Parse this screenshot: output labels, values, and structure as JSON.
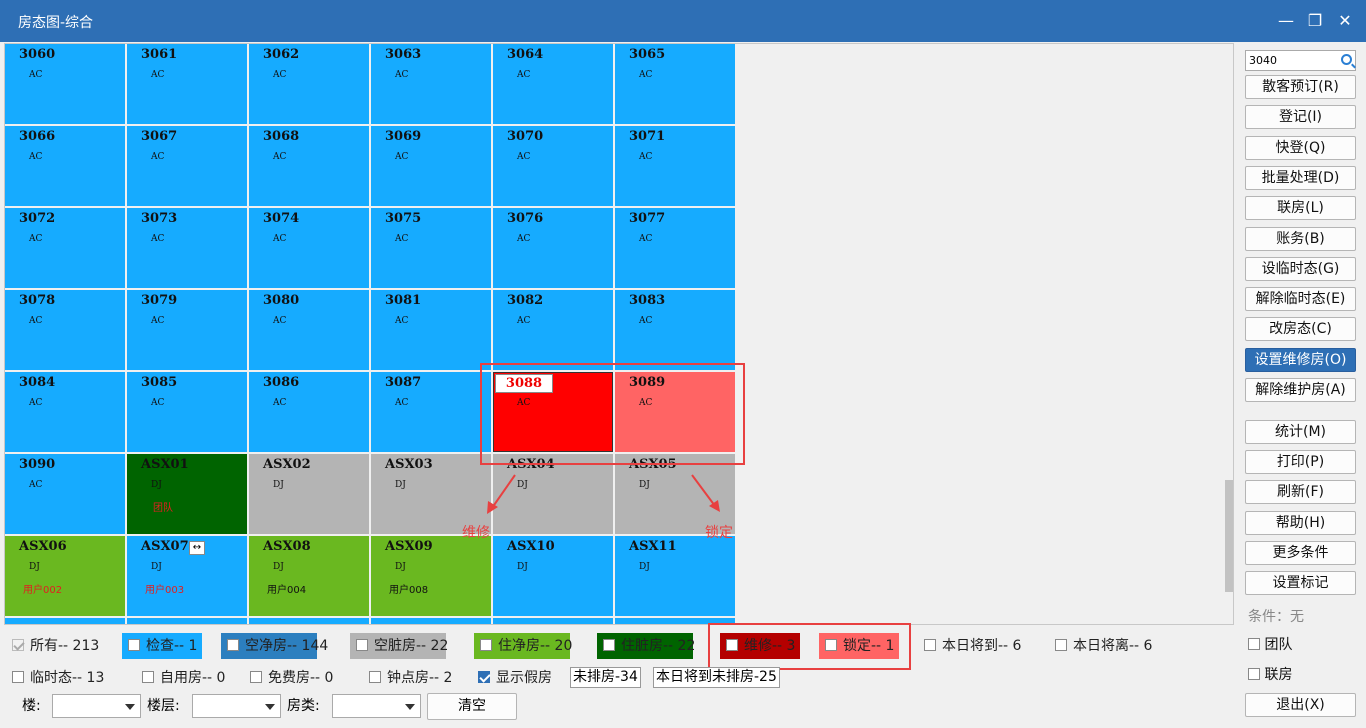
{
  "window": {
    "title": "房态图-综合",
    "minimize": "—",
    "restore": "❐",
    "close": "✕"
  },
  "rooms": [
    {
      "num": "3060",
      "type": "AC",
      "color": "blue"
    },
    {
      "num": "3061",
      "type": "AC",
      "color": "blue"
    },
    {
      "num": "3062",
      "type": "AC",
      "color": "blue"
    },
    {
      "num": "3063",
      "type": "AC",
      "color": "blue"
    },
    {
      "num": "3064",
      "type": "AC",
      "color": "blue"
    },
    {
      "num": "3065",
      "type": "AC",
      "color": "blue"
    },
    {
      "num": "3066",
      "type": "AC",
      "color": "blue"
    },
    {
      "num": "3067",
      "type": "AC",
      "color": "blue"
    },
    {
      "num": "3068",
      "type": "AC",
      "color": "blue"
    },
    {
      "num": "3069",
      "type": "AC",
      "color": "blue"
    },
    {
      "num": "3070",
      "type": "AC",
      "color": "blue"
    },
    {
      "num": "3071",
      "type": "AC",
      "color": "blue"
    },
    {
      "num": "3072",
      "type": "AC",
      "color": "blue"
    },
    {
      "num": "3073",
      "type": "AC",
      "color": "blue"
    },
    {
      "num": "3074",
      "type": "AC",
      "color": "blue"
    },
    {
      "num": "3075",
      "type": "AC",
      "color": "blue"
    },
    {
      "num": "3076",
      "type": "AC",
      "color": "blue"
    },
    {
      "num": "3077",
      "type": "AC",
      "color": "blue"
    },
    {
      "num": "3078",
      "type": "AC",
      "color": "blue"
    },
    {
      "num": "3079",
      "type": "AC",
      "color": "blue"
    },
    {
      "num": "3080",
      "type": "AC",
      "color": "blue"
    },
    {
      "num": "3081",
      "type": "AC",
      "color": "blue"
    },
    {
      "num": "3082",
      "type": "AC",
      "color": "blue"
    },
    {
      "num": "3083",
      "type": "AC",
      "color": "blue"
    },
    {
      "num": "3084",
      "type": "AC",
      "color": "blue"
    },
    {
      "num": "3085",
      "type": "AC",
      "color": "blue"
    },
    {
      "num": "3086",
      "type": "AC",
      "color": "blue"
    },
    {
      "num": "3087",
      "type": "AC",
      "color": "blue"
    },
    {
      "num": "3088",
      "type": "AC",
      "color": "red",
      "selected": true
    },
    {
      "num": "3089",
      "type": "AC",
      "color": "pink"
    },
    {
      "num": "3090",
      "type": "AC",
      "color": "blue"
    },
    {
      "num": "ASX01",
      "type": "DJ",
      "color": "dgreen",
      "extra": "团队",
      "extraRed": true
    },
    {
      "num": "ASX02",
      "type": "DJ",
      "color": "gray"
    },
    {
      "num": "ASX03",
      "type": "DJ",
      "color": "gray"
    },
    {
      "num": "ASX04",
      "type": "DJ",
      "color": "gray"
    },
    {
      "num": "ASX05",
      "type": "DJ",
      "color": "gray"
    },
    {
      "num": "ASX06",
      "type": "DJ",
      "color": "green",
      "extra": "用户002",
      "extraRed": true
    },
    {
      "num": "ASX07",
      "type": "DJ",
      "color": "blue",
      "extra": "用户003",
      "extraRed": true,
      "tag": "↔"
    },
    {
      "num": "ASX08",
      "type": "DJ",
      "color": "green",
      "extra": "用户004"
    },
    {
      "num": "ASX09",
      "type": "DJ",
      "color": "green",
      "extra": "用户008"
    },
    {
      "num": "ASX10",
      "type": "DJ",
      "color": "blue"
    },
    {
      "num": "ASX11",
      "type": "DJ",
      "color": "blue"
    }
  ],
  "colors": {
    "blue": "#16abff",
    "green": "#6ab820",
    "dgreen": "#006400",
    "gray": "#b4b4b4",
    "red": "#ff0000",
    "pink": "#ff6464"
  },
  "annotations": {
    "repair": "维修",
    "lock": "锁定"
  },
  "sidebar": {
    "search_value": "3040",
    "buttons": [
      "散客预订(R)",
      "登记(I)",
      "快登(Q)",
      "批量处理(D)",
      "联房(L)",
      "账务(B)",
      "设临时态(G)",
      "解除临时态(E)",
      "改房态(C)",
      "设置维修房(O)",
      "解除维护房(A)"
    ],
    "active_button": "设置维修房(O)",
    "buttons2": [
      "统计(M)",
      "打印(P)",
      "刷新(F)",
      "帮助(H)",
      "更多条件",
      "设置标记"
    ],
    "condition": "条件：无",
    "team": "团队",
    "linked": "联房",
    "exit": "退出(X)"
  },
  "filters": {
    "all": "所有-- 213",
    "check": "检查-- 1",
    "vacant_clean": "空净房-- 144",
    "vacant_dirty": "空脏房-- 22",
    "occ_clean": "住净房-- 20",
    "occ_dirty": "住脏房-- 22",
    "repair": "维修-- 3",
    "lock": "锁定-- 1",
    "arriving": "本日将到-- 6",
    "leaving": "本日将离-- 6",
    "temp": "临时态-- 13",
    "self_use": "自用房-- 0",
    "free": "免费房-- 0",
    "hourly": "钟点房-- 2",
    "show_fake": "显示假房",
    "unassigned": "未排房-34",
    "arriving_unassigned": "本日将到未排房-25",
    "building_label": "楼:",
    "floor_label": "楼层:",
    "room_type_label": "房类:",
    "clear": "清空"
  }
}
